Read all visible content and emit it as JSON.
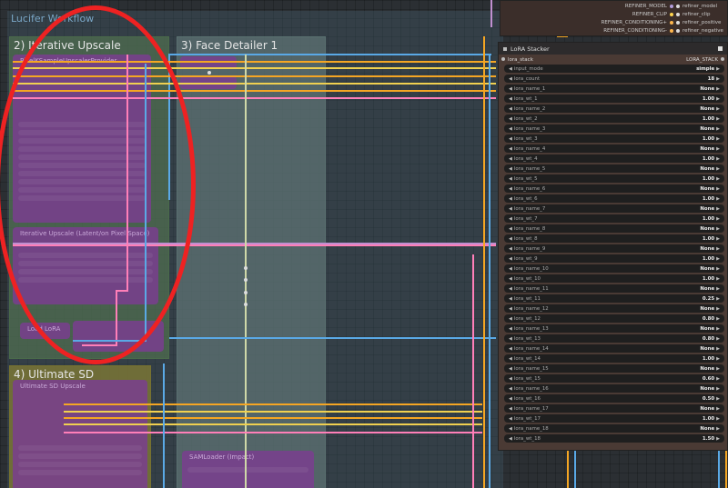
{
  "workflow": {
    "title": "Lucifer Workflow",
    "groups": {
      "iterative_upscale": "2) Iterative Upscale",
      "face_detailer": "3) Face Detailer 1",
      "ultimate_sd": "4) Ultimate SD"
    }
  },
  "refiner": {
    "outputs": [
      {
        "name": "REFINER_MODEL",
        "target": "refiner_model",
        "color": "#b39ddb"
      },
      {
        "name": "REFINER_CLIP",
        "target": "refiner_clip",
        "color": "#ffd54f"
      },
      {
        "name": "REFINER_CONDITIONING+",
        "target": "refiner_positive",
        "color": "#ffb74d"
      },
      {
        "name": "REFINER_CONDITIONING-",
        "target": "refiner_negative",
        "color": "#ffb74d"
      }
    ]
  },
  "lora_stacker": {
    "title": "LoRA Stacker",
    "input_label": "lora_stack",
    "output_label": "LORA_STACK",
    "widgets": [
      {
        "label": "input_mode",
        "value": "simple"
      },
      {
        "label": "lora_count",
        "value": "18"
      },
      {
        "label": "lora_name_1",
        "value": "None"
      },
      {
        "label": "lora_wt_1",
        "value": "1.00"
      },
      {
        "label": "lora_name_2",
        "value": "None"
      },
      {
        "label": "lora_wt_2",
        "value": "1.00"
      },
      {
        "label": "lora_name_3",
        "value": "None"
      },
      {
        "label": "lora_wt_3",
        "value": "1.00"
      },
      {
        "label": "lora_name_4",
        "value": "None"
      },
      {
        "label": "lora_wt_4",
        "value": "1.00"
      },
      {
        "label": "lora_name_5",
        "value": "None"
      },
      {
        "label": "lora_wt_5",
        "value": "1.00"
      },
      {
        "label": "lora_name_6",
        "value": "None"
      },
      {
        "label": "lora_wt_6",
        "value": "1.00"
      },
      {
        "label": "lora_name_7",
        "value": "None"
      },
      {
        "label": "lora_wt_7",
        "value": "1.00"
      },
      {
        "label": "lora_name_8",
        "value": "None"
      },
      {
        "label": "lora_wt_8",
        "value": "1.00"
      },
      {
        "label": "lora_name_9",
        "value": "None"
      },
      {
        "label": "lora_wt_9",
        "value": "1.00"
      },
      {
        "label": "lora_name_10",
        "value": "None"
      },
      {
        "label": "lora_wt_10",
        "value": "1.00"
      },
      {
        "label": "lora_name_11",
        "value": "None"
      },
      {
        "label": "lora_wt_11",
        "value": "0.25"
      },
      {
        "label": "lora_name_12",
        "value": "None"
      },
      {
        "label": "lora_wt_12",
        "value": "0.80"
      },
      {
        "label": "lora_name_13",
        "value": "None"
      },
      {
        "label": "lora_wt_13",
        "value": "0.80"
      },
      {
        "label": "lora_name_14",
        "value": "None"
      },
      {
        "label": "lora_wt_14",
        "value": "1.00"
      },
      {
        "label": "lora_name_15",
        "value": "None"
      },
      {
        "label": "lora_wt_15",
        "value": "0.60"
      },
      {
        "label": "lora_name_16",
        "value": "None"
      },
      {
        "label": "lora_wt_16",
        "value": "0.50"
      },
      {
        "label": "lora_name_17",
        "value": "None"
      },
      {
        "label": "lora_wt_17",
        "value": "1.00"
      },
      {
        "label": "lora_name_18",
        "value": "None"
      },
      {
        "label": "lora_wt_18",
        "value": "1.50"
      }
    ]
  },
  "nodes": {
    "upscale_provider": "PixelKSampleUpscalerProvider",
    "iterative_upscale_node": "Iterative Upscale (Latent/on Pixel Space)",
    "load_lora": "Load LoRA",
    "ultimate_sd_upscale": "Ultimate SD Upscale",
    "sams_detector": "SAMLoader (Impact)"
  },
  "colors": {
    "group_iterative": "#4f6d4f",
    "group_face": "#5d7373",
    "group_ultimate": "#7a7536",
    "node_purple": "#7a3e8f",
    "annotation": "#e22222",
    "wire_orange": "#f5a623",
    "wire_blue": "#5aa9e6",
    "wire_pink": "#ff7fb8",
    "wire_yellow": "#f0d050",
    "wire_mauve": "#c08fd0"
  }
}
